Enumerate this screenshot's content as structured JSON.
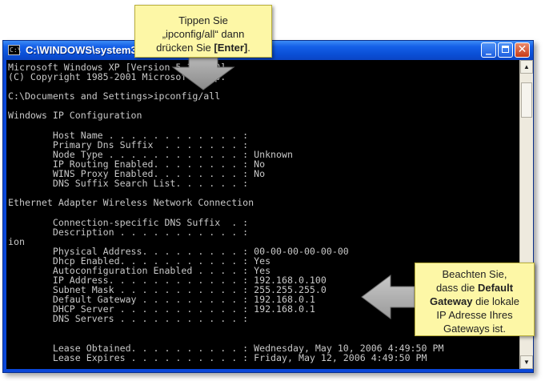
{
  "window": {
    "title": "C:\\WINDOWS\\system32",
    "icon_name": "cmd-icon",
    "icon_glyph": "C:\\",
    "minimize_glyph": "_",
    "close_glyph": "✕"
  },
  "console_lines": [
    "Microsoft Windows XP [Version 5.1.2600]",
    "(C) Copyright 1985-2001 Microsoft Corp.",
    "",
    "C:\\Documents and Settings>ipconfig/all",
    "",
    "Windows IP Configuration",
    "",
    "        Host Name . . . . . . . . . . . . :",
    "        Primary Dns Suffix  . . . . . . . :",
    "        Node Type . . . . . . . . . . . . : Unknown",
    "        IP Routing Enabled. . . . . . . . : No",
    "        WINS Proxy Enabled. . . . . . . . : No",
    "        DNS Suffix Search List. . . . . . :",
    "",
    "Ethernet Adapter Wireless Network Connection",
    "",
    "        Connection-specific DNS Suffix  . :",
    "        Description . . . . . . . . . . . :",
    "ion",
    "        Physical Address. . . . . . . . . : 00-00-00-00-00-00",
    "        Dhcp Enabled. . . . . . . . . . . : Yes",
    "        Autoconfiguration Enabled . . . . : Yes",
    "        IP Address. . . . . . . . . . . . : 192.168.0.100",
    "        Subnet Mask . . . . . . . . . . . : 255.255.255.0",
    "        Default Gateway . . . . . . . . . : 192.168.0.1",
    "        DHCP Server . . . . . . . . . . . : 192.168.0.1",
    "        DNS Servers . . . . . . . . . . . :",
    "",
    "",
    "        Lease Obtained. . . . . . . . . . : Wednesday, May 10, 2006 4:49:50 PM",
    "        Lease Expires . . . . . . . . . . : Friday, May 12, 2006 4:49:50 PM"
  ],
  "callout_top": {
    "line1": "Tippen Sie",
    "line2": "„ipconfig/all“ dann",
    "line3_pre": "drücken Sie ",
    "line3_bold": "[Enter]",
    "line3_post": "."
  },
  "callout_right": {
    "line1": "Beachten Sie,",
    "line2_pre": "dass die ",
    "line2_bold": "Default",
    "line3_bold": "Gateway",
    "line3_post": " die lokale",
    "line4": "IP Adresse Ihres",
    "line5": "Gateways ist."
  },
  "scrollbar": {
    "up_glyph": "▲",
    "down_glyph": "▼"
  },
  "colors": {
    "console_bg": "#000000",
    "console_text": "#c8c8c8",
    "titlebar": "#0a4fd6",
    "callout_bg": "#fdf7a6"
  }
}
